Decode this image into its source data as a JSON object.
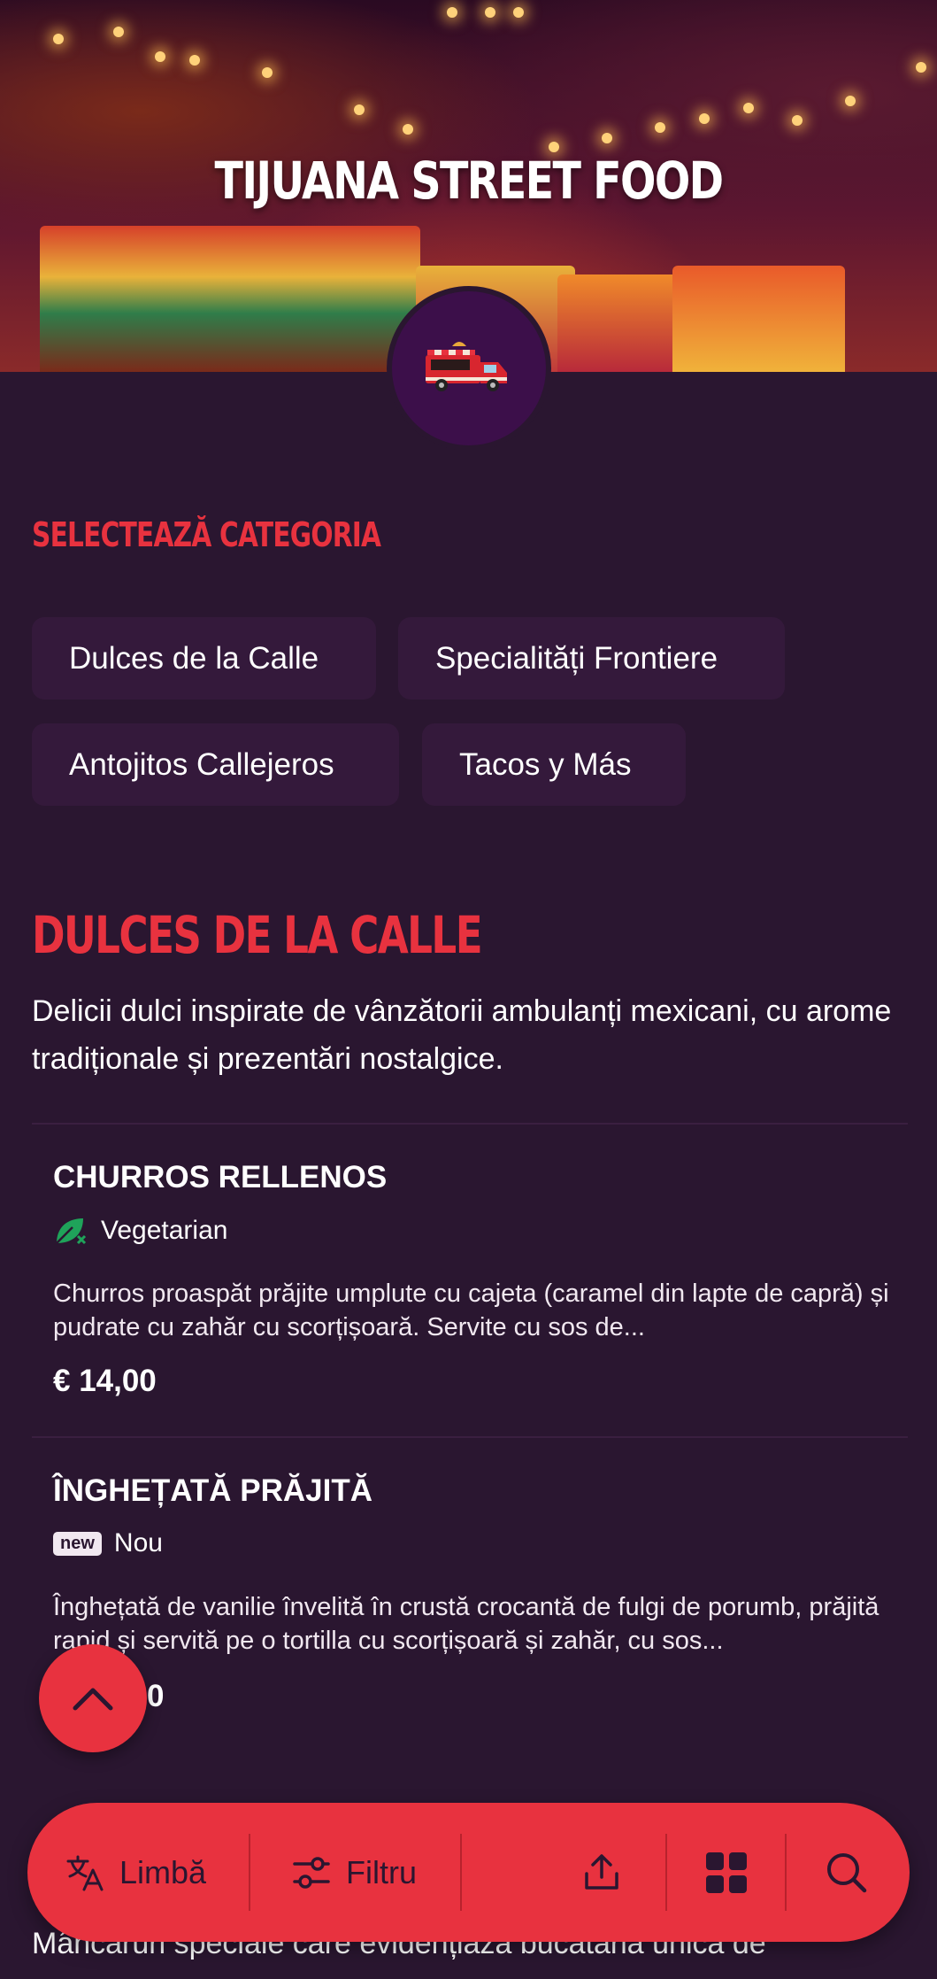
{
  "restaurant": {
    "name": "TIJUANA STREET FOOD"
  },
  "categories_section": {
    "label": "SELECTEAZĂ CATEGORIA",
    "chips": [
      "Dulces de la Calle",
      "Specialități Frontiere",
      "Antojitos Callejeros",
      "Tacos y Más"
    ]
  },
  "category": {
    "title": "DULCES DE LA CALLE",
    "description": "Delicii dulci inspirate de vânzătorii ambulanți mexicani, cu arome tradiționale și prezentări nostalgice."
  },
  "items": [
    {
      "name": "CHURROS RELLENOS",
      "tag": "Vegetarian",
      "tag_icon": "leaf-icon",
      "description": "Churros proaspăt prăjite umplute cu cajeta (caramel din lapte de capră) și pudrate cu zahăr cu scorțișoară. Servite cu sos de...",
      "price": "€ 14,00"
    },
    {
      "name": "ÎNGHEȚATĂ PRĂJITĂ",
      "tag_badge": "new",
      "tag": "Nou",
      "description": "Înghețată de vanilie învelită în crustă crocantă de fulgi de porumb, prăjită rapid și servită pe o tortilla cu scorțișoară și zahăr, cu sos...",
      "price": "0"
    }
  ],
  "next_section_preview": "Mâncăruri speciale care evidențiază bucătăria unică de",
  "bottom_bar": {
    "language_label": "Limbă",
    "filter_label": "Filtru"
  },
  "colors": {
    "background": "#2a1630",
    "accent": "#e8323f",
    "chip": "#34193b"
  }
}
